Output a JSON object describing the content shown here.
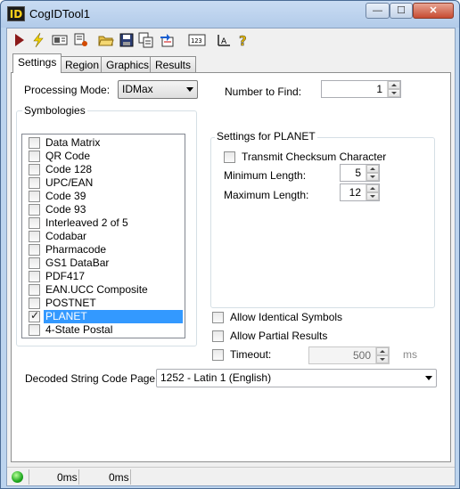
{
  "window": {
    "title": "CogIDTool1",
    "icon_text": "ID",
    "minimize": "—",
    "maximize": "☐",
    "close": "✕"
  },
  "toolbar": {
    "icons": [
      "run-icon",
      "trigger-icon",
      "image-icon",
      "settings-icon",
      "open-icon",
      "save-icon",
      "copy-icon",
      "reset-icon",
      "counter-icon",
      "train-icon",
      "help-icon"
    ]
  },
  "tabs": [
    "Settings",
    "Region",
    "Graphics",
    "Results"
  ],
  "settings": {
    "processing_mode_label": "Processing Mode:",
    "processing_mode_value": "IDMax",
    "number_to_find_label": "Number to Find:",
    "number_to_find_value": "1",
    "symbologies_title": "Symbologies",
    "symbologies": [
      {
        "label": "Data Matrix",
        "checked": false
      },
      {
        "label": "QR Code",
        "checked": false
      },
      {
        "label": "Code 128",
        "checked": false
      },
      {
        "label": "UPC/EAN",
        "checked": false
      },
      {
        "label": "Code 39",
        "checked": false
      },
      {
        "label": "Code 93",
        "checked": false
      },
      {
        "label": "Interleaved 2 of 5",
        "checked": false
      },
      {
        "label": "Codabar",
        "checked": false
      },
      {
        "label": "Pharmacode",
        "checked": false
      },
      {
        "label": "GS1 DataBar",
        "checked": false
      },
      {
        "label": "PDF417",
        "checked": false
      },
      {
        "label": "EAN.UCC Composite",
        "checked": false
      },
      {
        "label": "POSTNET",
        "checked": false
      },
      {
        "label": "PLANET",
        "checked": true,
        "selected": true
      },
      {
        "label": "4-State Postal",
        "checked": false
      }
    ],
    "planet_title": "Settings for PLANET",
    "transmit_checksum_label": "Transmit Checksum Character",
    "min_length_label": "Minimum Length:",
    "min_length_value": "5",
    "max_length_label": "Maximum Length:",
    "max_length_value": "12",
    "allow_identical_label": "Allow Identical Symbols",
    "allow_partial_label": "Allow Partial Results",
    "timeout_label": "Timeout:",
    "timeout_value": "500",
    "timeout_unit": "ms",
    "code_page_label": "Decoded String Code Page:",
    "code_page_value": "1252 - Latin 1 (English)"
  },
  "status": {
    "time1": "0ms",
    "time2": "0ms"
  },
  "colors": {
    "selection": "#3399ff",
    "titlebar": "#b9d1ea",
    "status_led": "#1fa81f"
  }
}
